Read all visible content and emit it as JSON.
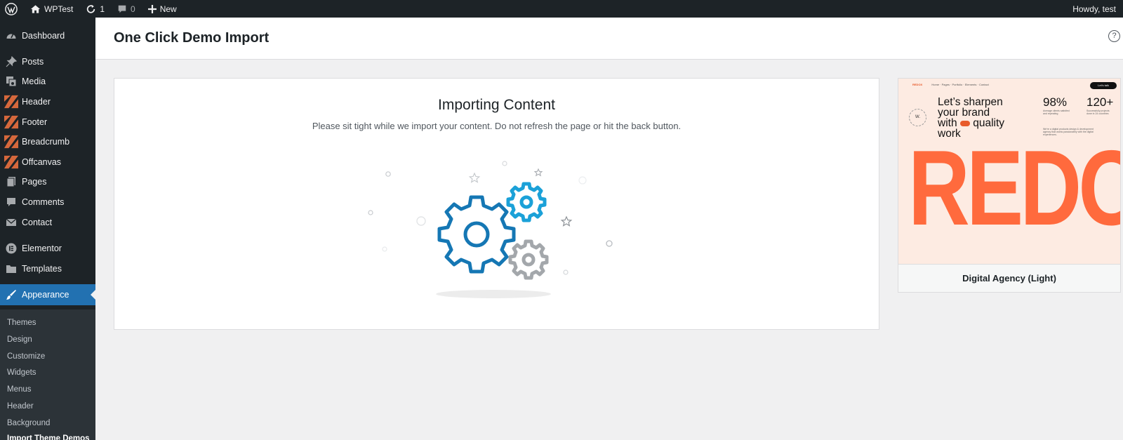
{
  "admin_bar": {
    "site_name": "WPTest",
    "updates_count": "1",
    "comments_count": "0",
    "new_label": "New",
    "greeting": "Howdy, test"
  },
  "sidebar": {
    "items": [
      {
        "label": "Dashboard",
        "icon": "dashboard-icon"
      },
      {
        "label": "Posts",
        "icon": "pin-icon"
      },
      {
        "label": "Media",
        "icon": "media-icon"
      },
      {
        "label": "Header",
        "icon": "theme-builder-icon"
      },
      {
        "label": "Footer",
        "icon": "theme-builder-icon"
      },
      {
        "label": "Breadcrumb",
        "icon": "theme-builder-icon"
      },
      {
        "label": "Offcanvas",
        "icon": "theme-builder-icon"
      },
      {
        "label": "Pages",
        "icon": "pages-icon"
      },
      {
        "label": "Comments",
        "icon": "comment-icon"
      },
      {
        "label": "Contact",
        "icon": "mail-icon"
      },
      {
        "label": "Elementor",
        "icon": "elementor-icon"
      },
      {
        "label": "Templates",
        "icon": "folder-icon"
      },
      {
        "label": "Appearance",
        "icon": "paintbrush-icon"
      }
    ],
    "submenu": [
      "Themes",
      "Design",
      "Customize",
      "Widgets",
      "Menus",
      "Header",
      "Background",
      "Import Theme Demos"
    ]
  },
  "page": {
    "title": "One Click Demo Import",
    "help_label": "?"
  },
  "importer": {
    "title": "Importing Content",
    "subtitle": "Please sit tight while we import your content. Do not refresh the page or hit the back button."
  },
  "demo": {
    "name": "Digital Agency (Light)",
    "preview": {
      "logo": "REDOX",
      "nav": "Home ·  Pages ·  Portfolio ·  Elements ·  Contact",
      "nav_button": "Let's talk",
      "headline_1": "Let’s sharpen",
      "headline_2": "your brand",
      "headline_3a": "with",
      "headline_3b": "quality",
      "headline_4": "work",
      "stat1_value": "98%",
      "stat1_text": "Average clients satisfied and repeating",
      "stat2_value": "120+",
      "stat2_text": "Successfully projects done in 24 countries",
      "blurb": "We're a digital products design & development agency that works passionately with the digital experiences.",
      "badge": "W.",
      "big_word": "REDOX"
    }
  },
  "colors": {
    "adminbar_bg": "#1d2327",
    "active_menu": "#2271b1",
    "gear_blue": "#1577b4",
    "gear_cyan": "#1ba1d8",
    "gear_gray": "#a3a7ab",
    "brand_orange": "#ff6a3d"
  }
}
